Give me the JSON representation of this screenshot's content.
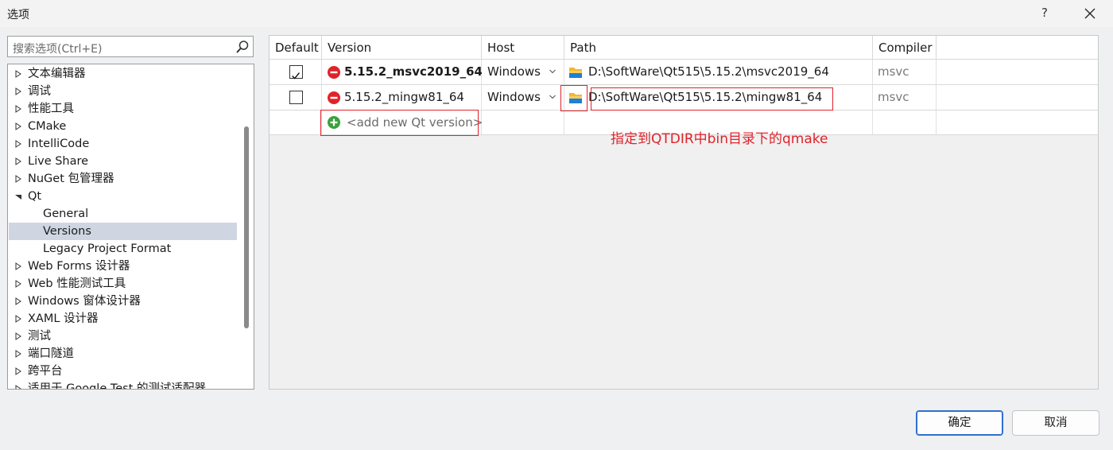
{
  "window": {
    "title": "选项",
    "help": "?"
  },
  "search": {
    "placeholder": "搜索选项(Ctrl+E)"
  },
  "tree": [
    {
      "label": "文本编辑器",
      "expanded": false
    },
    {
      "label": "调试",
      "expanded": false
    },
    {
      "label": "性能工具",
      "expanded": false
    },
    {
      "label": "CMake",
      "expanded": false
    },
    {
      "label": "IntelliCode",
      "expanded": false
    },
    {
      "label": "Live Share",
      "expanded": false
    },
    {
      "label": "NuGet 包管理器",
      "expanded": false
    },
    {
      "label": "Qt",
      "expanded": true
    },
    {
      "label": "General",
      "child": true
    },
    {
      "label": "Versions",
      "child": true,
      "selected": true
    },
    {
      "label": "Legacy Project Format",
      "child": true
    },
    {
      "label": "Web Forms 设计器",
      "expanded": false
    },
    {
      "label": "Web 性能测试工具",
      "expanded": false
    },
    {
      "label": "Windows 窗体设计器",
      "expanded": false
    },
    {
      "label": "XAML 设计器",
      "expanded": false
    },
    {
      "label": "测试",
      "expanded": false
    },
    {
      "label": "端口隧道",
      "expanded": false
    },
    {
      "label": "跨平台",
      "expanded": false
    },
    {
      "label": "适用于 Google Test 的测试适配器",
      "expanded": false
    }
  ],
  "grid": {
    "headers": {
      "default": "Default",
      "version": "Version",
      "host": "Host",
      "path": "Path",
      "compiler": "Compiler"
    },
    "rows": [
      {
        "default": true,
        "version": "5.15.2_msvc2019_64",
        "host": "Windows",
        "path": "D:\\SoftWare\\Qt515\\5.15.2\\msvc2019_64",
        "compiler": "msvc"
      },
      {
        "default": false,
        "version": "5.15.2_mingw81_64",
        "host": "Windows",
        "path": "D:\\SoftWare\\Qt515\\5.15.2\\mingw81_64",
        "compiler": "msvc"
      }
    ],
    "add_new": "<add new Qt version>"
  },
  "annotation": "指定到QTDIR中bin目录下的qmake",
  "buttons": {
    "ok": "确定",
    "cancel": "取消"
  },
  "colors": {
    "annotation": "#e0232b",
    "selection": "#cfd6e2",
    "error": "#e0232b",
    "add": "#3aa13a",
    "folder": "#f2b632"
  }
}
